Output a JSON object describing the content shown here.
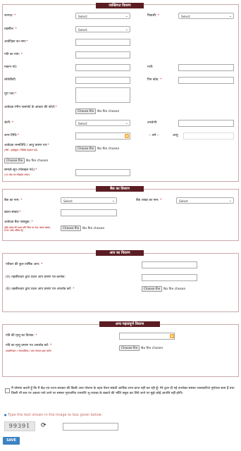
{
  "personal": {
    "title": "व्यक्तिगत विवरण",
    "district_label": "जनपद:",
    "district_value": "Select",
    "tehsil_label": "तहसील:",
    "tehsil_value": "Select",
    "resident_label": "निवासी:",
    "resident_value": "Select",
    "applicant_name_label": "आवेदिका का नाम:",
    "husband_name_label": "पति का नाम:",
    "house_no_label": "मकान नं0:",
    "street_label": "गली:",
    "locality_label": "लोकेलिटी:",
    "pincode_label": "पिन कोड:",
    "full_address_label": "पूरा पता:",
    "photo_label": "आवेदक रंगीन पासपोर्ट के आकार की फोटो:",
    "category_label": "श्रेणी:",
    "category_value": "Select",
    "subcategory_label": "उपश्रेणी:",
    "dob_label": "जन्म तिथि:",
    "dash": "-- वर्ष --",
    "age_label": "आयु:",
    "dob_proof_label": "आवेदक जन्मतिथि / आयु प्रमाण पत्र:",
    "dob_proof_hint": "(जैसे - हाईस्कूल / विशिष्ट पहचान पत्र)",
    "contact_label": "सम्पर्क सूत्र (मोबाइल नं0):",
    "contact_hint": "(10 अंक का मोबाइल नम्बर)"
  },
  "bank": {
    "title": "बैंक का विवरण",
    "bank_name_label": "बैंक का नाम:",
    "bank_name_value": "Select",
    "branch_label": "बैंक शाखा का नाम:",
    "branch_value": "Select",
    "account_label": "खाता संख्या:",
    "passbook_label": "आवेदक बैंक पासबुक:",
    "passbook_hint": "(बैंक खाता की प्रथम प्रति जिस पर नाम, खाता संख्या, IFSC कोड अंकित है)"
  },
  "income": {
    "title": "आय का विवरण",
    "annual_income_label": "परिवार की कुल वार्षिक आय:",
    "cert_no_label": "(A) तहसीलदार द्वारा प्रदत्त आय प्रमाण पत्र क्रमांक:",
    "cert_upload_label": "(B) तहसीलदार द्वारा प्रदत्त आय प्रमाण पत्र अपलोड करें:"
  },
  "other": {
    "title": "अन्य महत्वपूर्ण विवरण",
    "death_date_label": "पति की मृत्यु का दिनांक:",
    "death_cert_label": "पति का मृत्यु प्रमाण पत्र अपलोड करें:",
    "death_cert_hint": "(तहसीलदार / नगरपालिका / ग्राम पंचायत द्वारा जारी)"
  },
  "file": {
    "button": "Choose file",
    "status": "No file chosen"
  },
  "declaration": "मैं घोषणा करती हूँ कि मैं केंद्र एवं राज्य सरकार की किसी अन्य योजना के तहत पेंशन संबंधी आर्थिक लाभ प्राप्त नहीं कर रही हूँ। मेरे द्वारा दी गई उपरोक्त समस्त जानकारियां पूर्णतया सत्य हैं तथा किसी भी स्तर पर असत्य पाये जाने पर समस्त भुगतानित धनराशि भू-राजस्व के बकाये की भाँति वसूल कर लिये जाने पर मुझे कोई आपत्ति नहीं होगी।",
  "captcha": {
    "instruction": "Type the text shown in the image to box given below:",
    "code": "99391"
  },
  "save_label": "SAVE",
  "colors": {
    "header_bg": "#5b1d22",
    "required": "#cc0000",
    "save_bg": "#3b82c4"
  }
}
